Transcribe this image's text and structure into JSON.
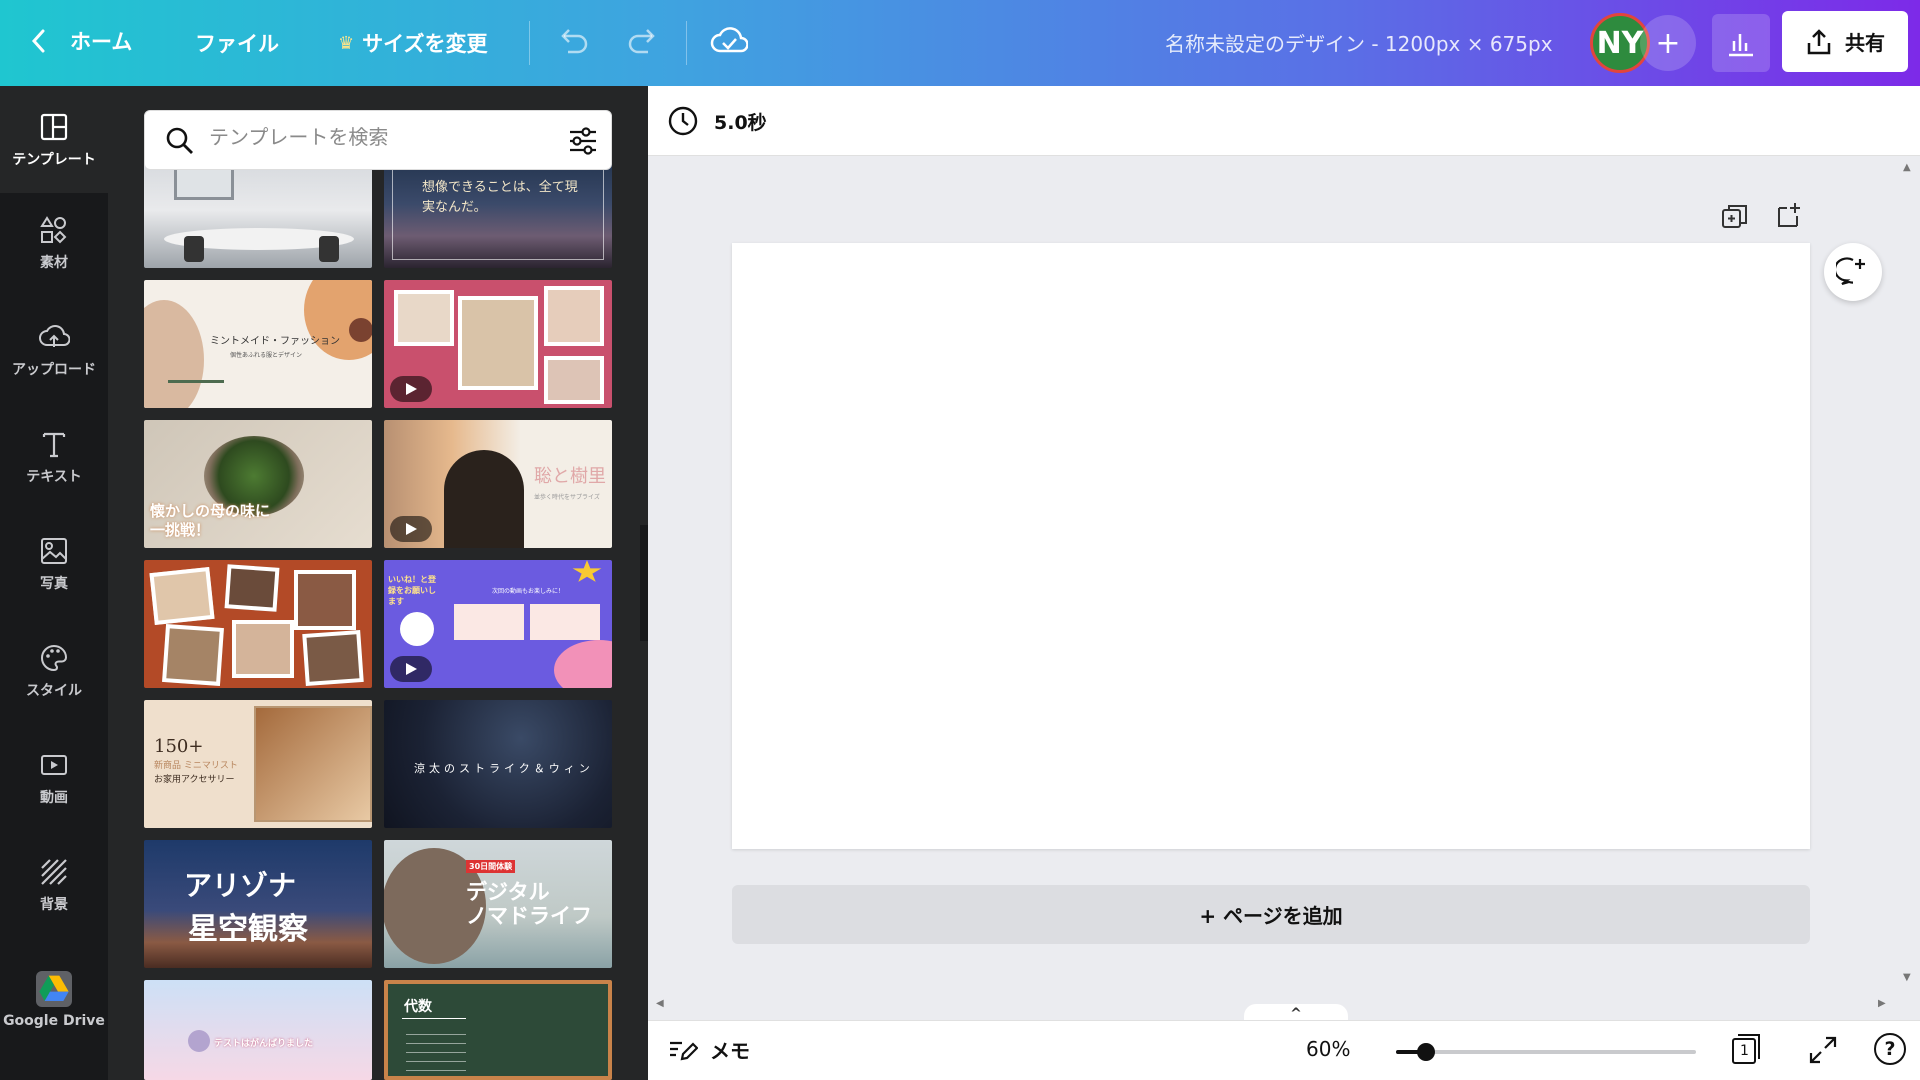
{
  "header": {
    "home_label": "ホーム",
    "file_label": "ファイル",
    "resize_label": "サイズを変更",
    "title": "名称未設定のデザイン - 1200px × 675px",
    "avatar_initials": "NY",
    "share_label": "共有"
  },
  "rail": {
    "items": [
      {
        "label": "テンプレート",
        "icon": "template-icon"
      },
      {
        "label": "素材",
        "icon": "elements-icon"
      },
      {
        "label": "アップロード",
        "icon": "upload-icon"
      },
      {
        "label": "テキスト",
        "icon": "text-icon"
      },
      {
        "label": "写真",
        "icon": "photo-icon"
      },
      {
        "label": "スタイル",
        "icon": "palette-icon"
      },
      {
        "label": "動画",
        "icon": "video-icon"
      },
      {
        "label": "背景",
        "icon": "background-icon"
      },
      {
        "label": "Google Drive",
        "icon": "google-drive-icon"
      }
    ]
  },
  "search": {
    "placeholder": "テンプレートを検索",
    "value": ""
  },
  "templates": {
    "t2_text": "想像できることは、全て現実なんだ。",
    "t3_title": "ミントメイド・ファッション",
    "t3_sub": "個性あふれる服とデザイン",
    "t5_text": "懐かしの母の味に一挑戦！",
    "t6_text": "聡と樹里",
    "t6_sub": "並歩く時代をサプライズ",
    "t8_text": "いいね！と登録をお願いします",
    "t8_sub": "次回の動画もお楽しみに！",
    "t9_title": "150+",
    "t9_sub1": "新商品 ミニマリスト",
    "t9_sub2": "お家用アクセサリー",
    "t10_text": "涼太のストライク＆ウィン",
    "t11_line1": "アリゾナ",
    "t11_line2": "星空観察",
    "t12_badge": "30日間体験",
    "t12_line1": "デジタル",
    "t12_line2": "ノマドライフ",
    "t13_text": "テストはがんばりました",
    "t14_title": "代数"
  },
  "editor": {
    "duration": "5.0秒",
    "add_page": "+ ページを追加",
    "notes_label": "メモ",
    "zoom": "60%",
    "zoom_level": 0.1,
    "page_number": "1"
  }
}
